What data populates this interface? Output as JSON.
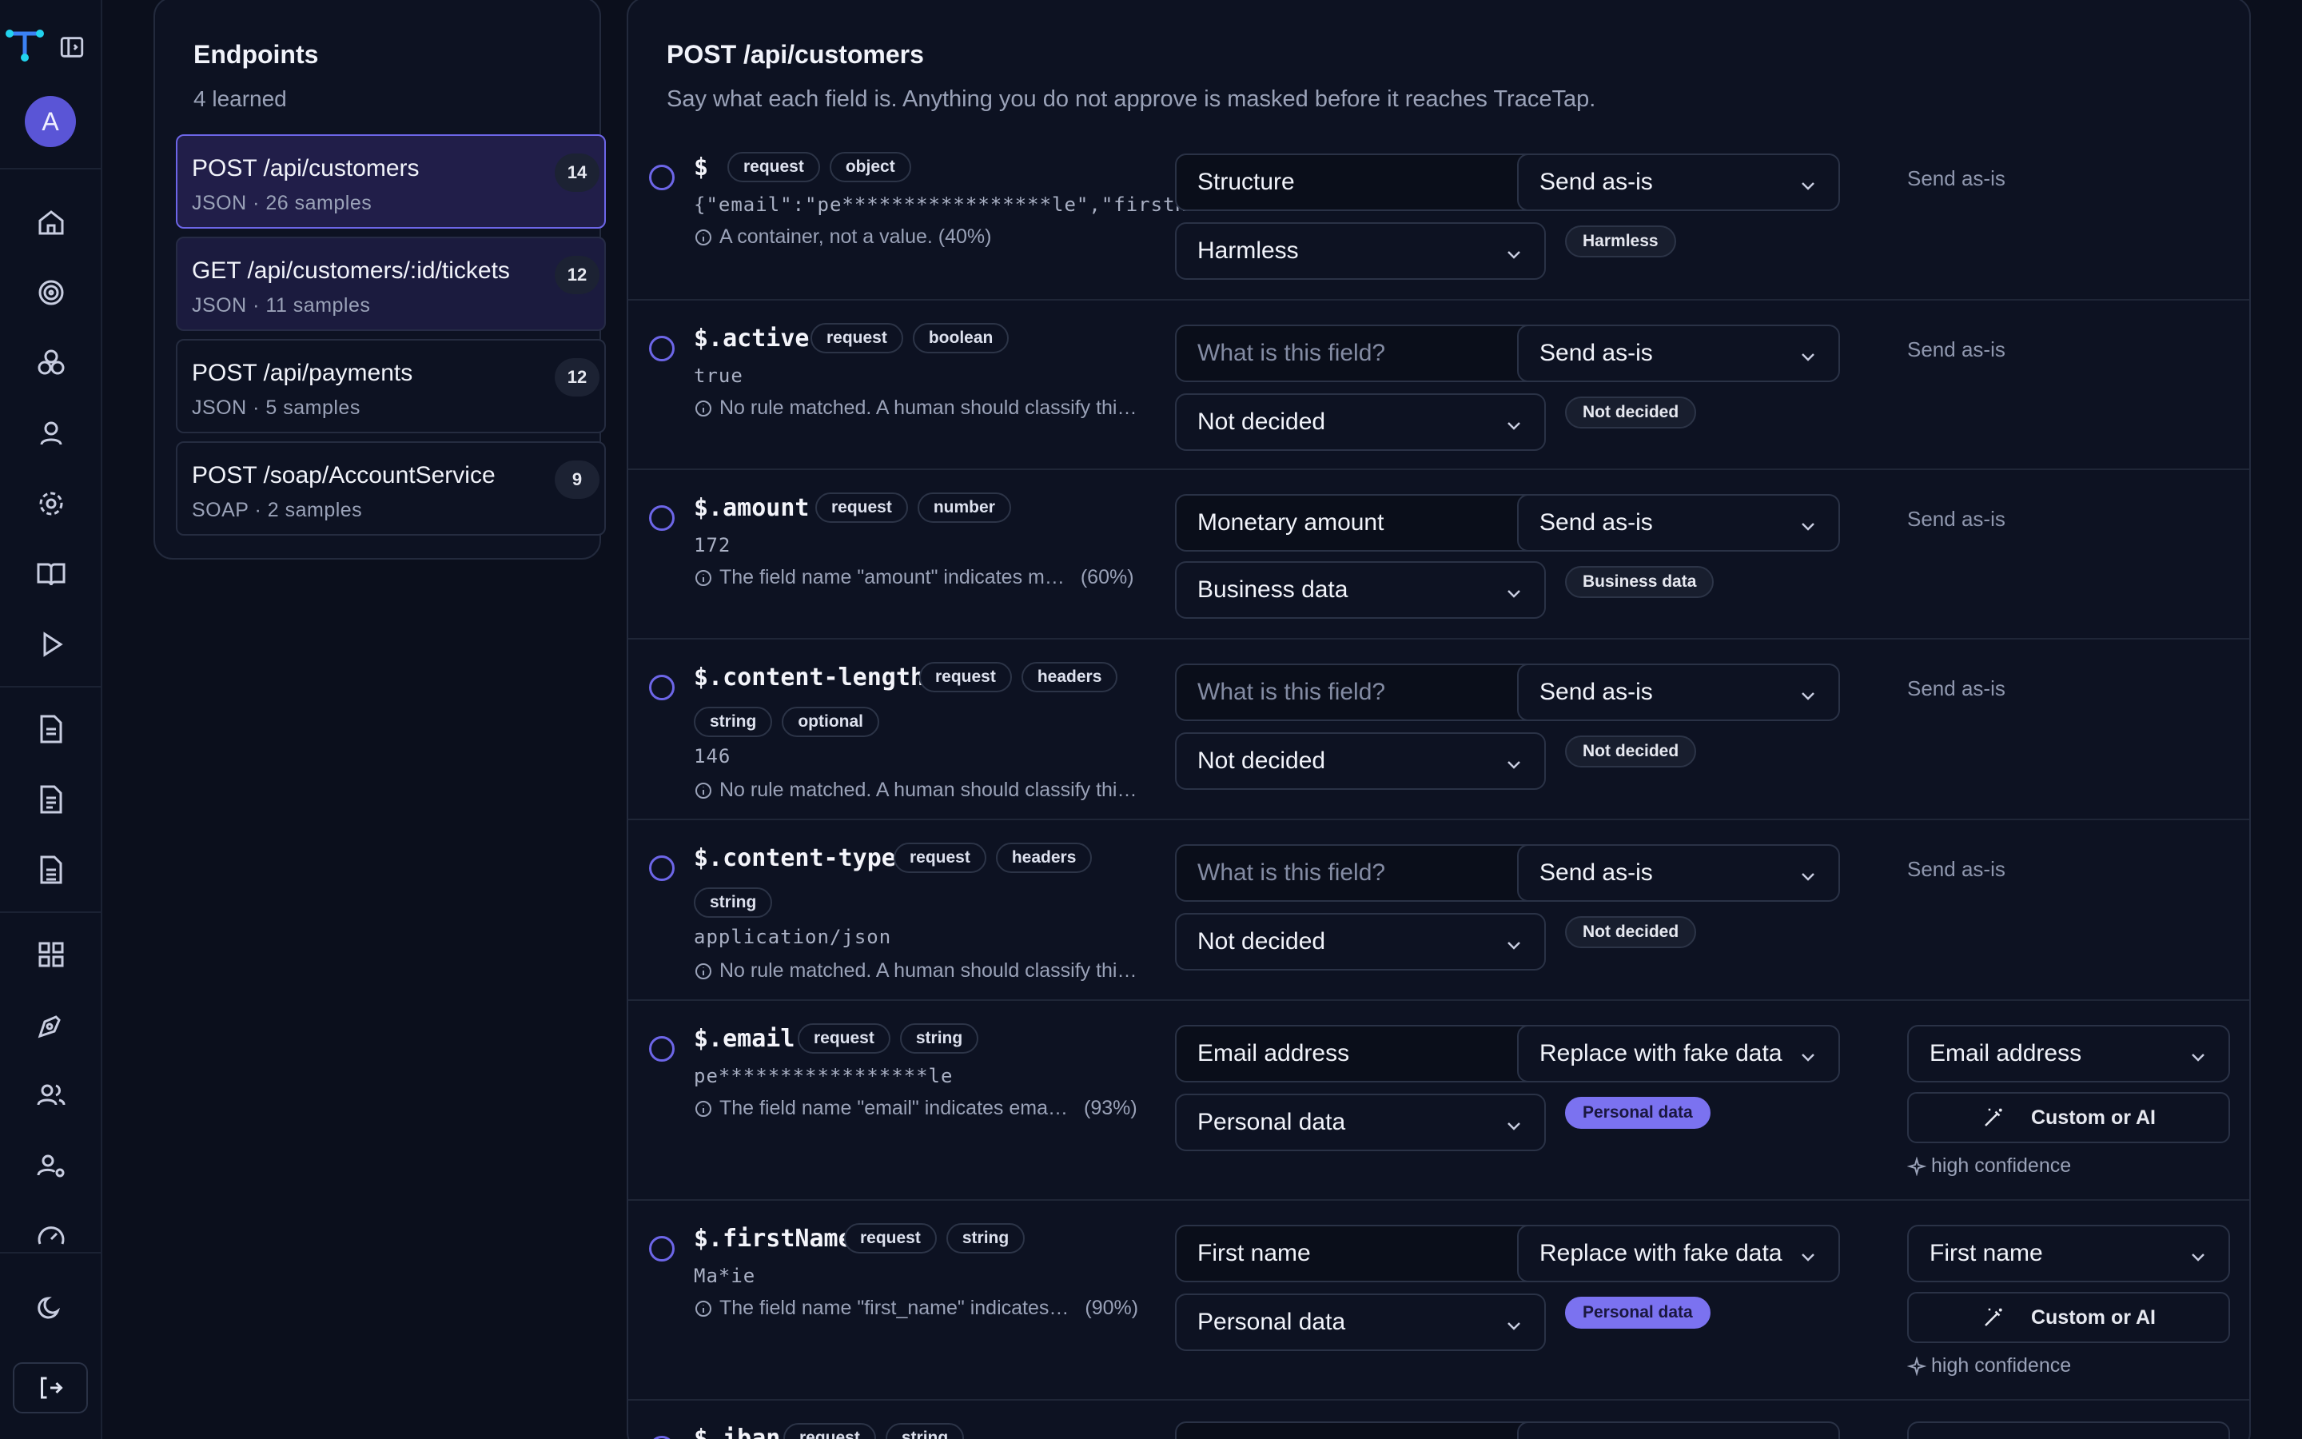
{
  "app": {
    "avatar_letter": "A",
    "accent": "#6d66e8",
    "logo_colors": [
      "#3b82f6",
      "#22d3ee"
    ]
  },
  "rail_icons": [
    "home-icon",
    "target-icon",
    "boxes-icon",
    "user-icon",
    "gear-icon",
    "book-icon",
    "play-icon",
    "document-icon",
    "document-icon",
    "document-icon",
    "dashboard-icon",
    "pen-tool-icon",
    "users-icon",
    "user-cog-icon",
    "gauge-icon",
    "moon-icon",
    "logout-icon"
  ],
  "endpoints": {
    "title": "Endpoints",
    "subtitle": "4 learned",
    "items": [
      {
        "name": "POST /api/customers",
        "meta": "JSON · 26 samples",
        "count": "14",
        "state": "selected"
      },
      {
        "name": "GET /api/customers/:id/tickets",
        "meta": "JSON · 11 samples",
        "count": "12",
        "state": "hover"
      },
      {
        "name": "POST /api/payments",
        "meta": "JSON · 5 samples",
        "count": "12",
        "state": "normal"
      },
      {
        "name": "POST /soap/AccountService",
        "meta": "SOAP · 2 samples",
        "count": "9",
        "state": "normal"
      }
    ]
  },
  "main": {
    "title": "POST /api/customers",
    "subtitle": "Say what each field is. Anything you do not approve is masked before it reaches TraceTap.",
    "fields": [
      {
        "path": "$",
        "chips": [
          "request",
          "object"
        ],
        "value": "{\"email\":\"pe*****************le\",\"firstN…",
        "reason": "A container, not a value. (40%)",
        "confidence": "",
        "label": "Structure",
        "label_placeholder": false,
        "category": "Harmless",
        "action": "Send as-is",
        "tag": "Harmless",
        "tag_style": "neutral",
        "generator": "Send as-is"
      },
      {
        "path": "$.active",
        "chips": [
          "request",
          "boolean"
        ],
        "value": "true",
        "reason": "No rule matched. A human should classify thi…",
        "confidence": "",
        "label": "What is this field?",
        "label_placeholder": true,
        "category": "Not decided",
        "action": "Send as-is",
        "tag": "Not decided",
        "tag_style": "neutral",
        "generator": "Send as-is"
      },
      {
        "path": "$.amount",
        "chips": [
          "request",
          "number"
        ],
        "value": "172",
        "reason": "The field name \"amount\" indicates m…",
        "confidence": "(60%)",
        "label": "Monetary amount",
        "label_placeholder": false,
        "category": "Business data",
        "action": "Send as-is",
        "tag": "Business data",
        "tag_style": "neutral",
        "generator": "Send as-is"
      },
      {
        "path": "$.content-length",
        "chips": [
          "request",
          "headers"
        ],
        "chips2": [
          "string",
          "optional"
        ],
        "value": "146",
        "reason": "No rule matched. A human should classify thi…",
        "confidence": "",
        "label": "What is this field?",
        "label_placeholder": true,
        "category": "Not decided",
        "action": "Send as-is",
        "tag": "Not decided",
        "tag_style": "neutral",
        "generator": "Send as-is"
      },
      {
        "path": "$.content-type",
        "chips": [
          "request",
          "headers"
        ],
        "chips2": [
          "string"
        ],
        "value": "application/json",
        "reason": "No rule matched. A human should classify thi…",
        "confidence": "",
        "label": "What is this field?",
        "label_placeholder": true,
        "category": "Not decided",
        "action": "Send as-is",
        "tag": "Not decided",
        "tag_style": "neutral",
        "generator": "Send as-is"
      },
      {
        "path": "$.email",
        "chips": [
          "request",
          "string"
        ],
        "value": "pe*****************le",
        "reason": "The field name \"email\" indicates ema…",
        "confidence": "(93%)",
        "label": "Email address",
        "label_placeholder": false,
        "category": "Personal data",
        "action": "Replace with fake data",
        "tag": "Personal data",
        "tag_style": "personal",
        "generator": "Email address",
        "custom_button": "Custom or AI",
        "confidence_note": "high confidence"
      },
      {
        "path": "$.firstName",
        "chips": [
          "request",
          "string"
        ],
        "value": "Ma*ie",
        "reason": "The field name \"first_name\" indicates…",
        "confidence": "(90%)",
        "label": "First name",
        "label_placeholder": false,
        "category": "Personal data",
        "action": "Replace with fake data",
        "tag": "Personal data",
        "tag_style": "personal",
        "generator": "First name",
        "custom_button": "Custom or AI",
        "confidence_note": "high confidence"
      },
      {
        "path": "$.iban",
        "chips": [
          "request",
          "string"
        ]
      }
    ]
  }
}
